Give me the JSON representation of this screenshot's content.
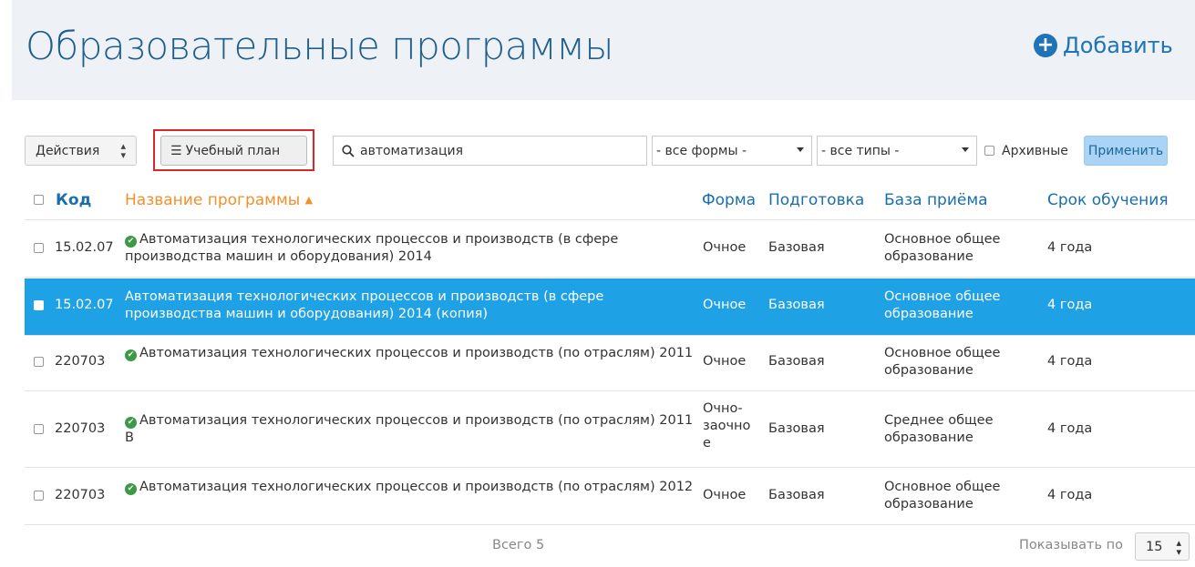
{
  "header": {
    "title": "Образовательные программы",
    "add_label": "Добавить"
  },
  "toolbar": {
    "actions_label": "Действия",
    "plan_label": "Учебный план",
    "search_value": "автоматизация",
    "forms_label": "- все формы -",
    "types_label": "- все типы -",
    "archive_label": "Архивные",
    "apply_label": "Применить"
  },
  "columns": {
    "code": "Код",
    "name": "Название программы",
    "form": "Форма",
    "prep": "Подготовка",
    "base": "База приёма",
    "term": "Срок обучения"
  },
  "rows": [
    {
      "code": "15.02.07",
      "name": "Автоматизация технологических процессов и производств (в сфере производства машин и оборудования) 2014",
      "form": "Очное",
      "prep": "Базовая",
      "base": "Основное общее образование",
      "term": "4 года",
      "checked": true,
      "selected": false
    },
    {
      "code": "15.02.07",
      "name": "Автоматизация технологических процессов и производств (в сфере производства машин и оборудования) 2014 (копия)",
      "form": "Очное",
      "prep": "Базовая",
      "base": "Основное общее образование",
      "term": "4 года",
      "checked": false,
      "selected": true
    },
    {
      "code": "220703",
      "name": "Автоматизация технологических процессов и производств (по отраслям) 2011",
      "form": "Очное",
      "prep": "Базовая",
      "base": "Основное общее образование",
      "term": "4 года",
      "checked": true,
      "selected": false
    },
    {
      "code": "220703",
      "name": "Автоматизация технологических процессов и производств (по отраслям) 2011 В",
      "form": "Очно-заочное",
      "form_lines": [
        "Очно-",
        "заочно",
        "е"
      ],
      "prep": "Базовая",
      "base": "Среднее общее образование",
      "term": "4 года",
      "checked": true,
      "selected": false
    },
    {
      "code": "220703",
      "name": "Автоматизация технологических процессов и производств (по отраслям) 2012",
      "form": "Очное",
      "prep": "Базовая",
      "base": "Основное общее образование",
      "term": "4 года",
      "checked": true,
      "selected": false
    }
  ],
  "footer": {
    "total": "Всего 5",
    "per_page_label": "Показывать по",
    "per_page_value": "15"
  },
  "colors": {
    "title": "#1f5f8b",
    "accent": "#1e74b6",
    "sorted_column": "#f0912c",
    "selected_row": "#1fa1e6",
    "highlight_frame": "#d9262c",
    "status_ok": "#3c9a46"
  },
  "icons": {
    "add": "plus-circle-icon",
    "plan": "list-ordered-icon",
    "search": "search-icon",
    "status": "check-circle-icon",
    "sort": "sort-up-icon"
  }
}
